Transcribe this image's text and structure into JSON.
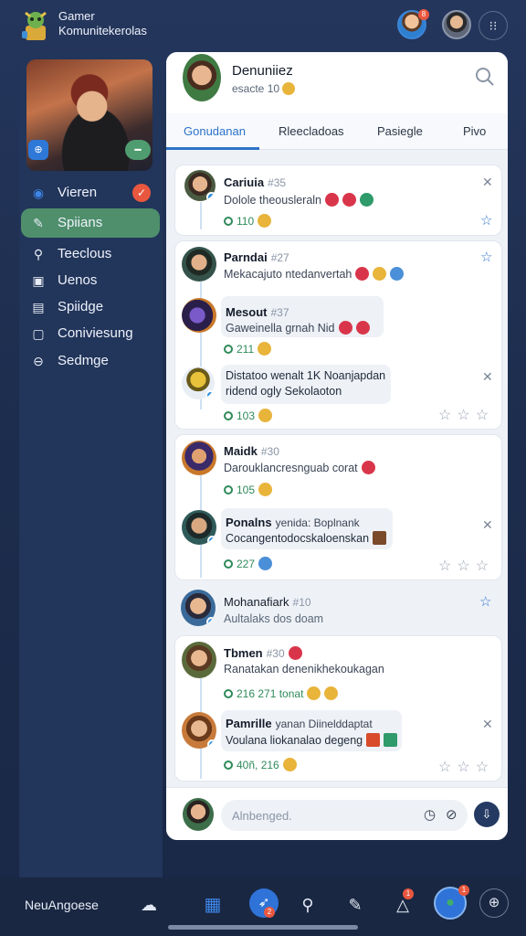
{
  "header": {
    "title_line1": "Gamer",
    "title_line2": "Komunitekerolas",
    "notification_count": "8"
  },
  "sidebar": {
    "nav": [
      {
        "label": "Vieren",
        "icon": "eye-icon",
        "badge": "✓"
      },
      {
        "label": "Spiians",
        "icon": "controller-icon",
        "active": true
      },
      {
        "label": "Teeclous",
        "icon": "wrench-icon"
      },
      {
        "label": "Uenos",
        "icon": "lock-icon"
      },
      {
        "label": "Spiidge",
        "icon": "cards-icon"
      },
      {
        "label": "Coniviesung",
        "icon": "square-icon"
      },
      {
        "label": "Sedmge",
        "icon": "gear-icon"
      }
    ]
  },
  "profile": {
    "name": "Denuniiez",
    "meta": "esacte 10"
  },
  "tabs": [
    "Gonudanan",
    "Rleecladoas",
    "Pasiegle",
    "Pivo"
  ],
  "posts": [
    {
      "name": "Cariuia",
      "rank": "#35",
      "text": "Dolole theousleraln",
      "stat": "110"
    },
    {
      "name": "Parndai",
      "rank": "#27",
      "text": "Mekacajuto ntedanvertah",
      "stat": ""
    },
    {
      "name": "Mesout",
      "rank": "#37",
      "text": "Gaweinella grnah Nid",
      "stat": "211"
    },
    {
      "name": "",
      "rank": "",
      "text_line1": "Distatoo wenalt 1K Noanjapdan",
      "text_line2": "ridend ogly Sekolaoton",
      "stat": "103"
    },
    {
      "name": "Maidk",
      "rank": "#30",
      "text": "Darouklancresnguab corat",
      "stat": "105"
    },
    {
      "name": "Ponalns",
      "rank": "yenida: Boplnank",
      "text": "Cocangentodocskaloenskan",
      "stat": "227"
    },
    {
      "name": "Mohanafiark",
      "rank": "#10",
      "text": "Aultalaks dos doam",
      "stat": ""
    },
    {
      "name": "Tbmen",
      "rank": "#30",
      "text": "Ranatakan denenikhekoukagan",
      "stat": "216  271  tonat"
    },
    {
      "name": "Pamrille",
      "rank": "yanan Diinelddaptat",
      "text": "Voulana liokanalao degeng",
      "stat": "40ñ, 216"
    }
  ],
  "compose": {
    "placeholder": "Alnbenged."
  },
  "bottom_bar": {
    "label": "NeuAngoese",
    "notif_a": "2",
    "notif_b": "1",
    "notif_c": "1"
  },
  "colors": {
    "accent": "#2d72c9",
    "active_nav": "#4f8f6c",
    "background": "#24365c",
    "badge": "#e9573f"
  }
}
